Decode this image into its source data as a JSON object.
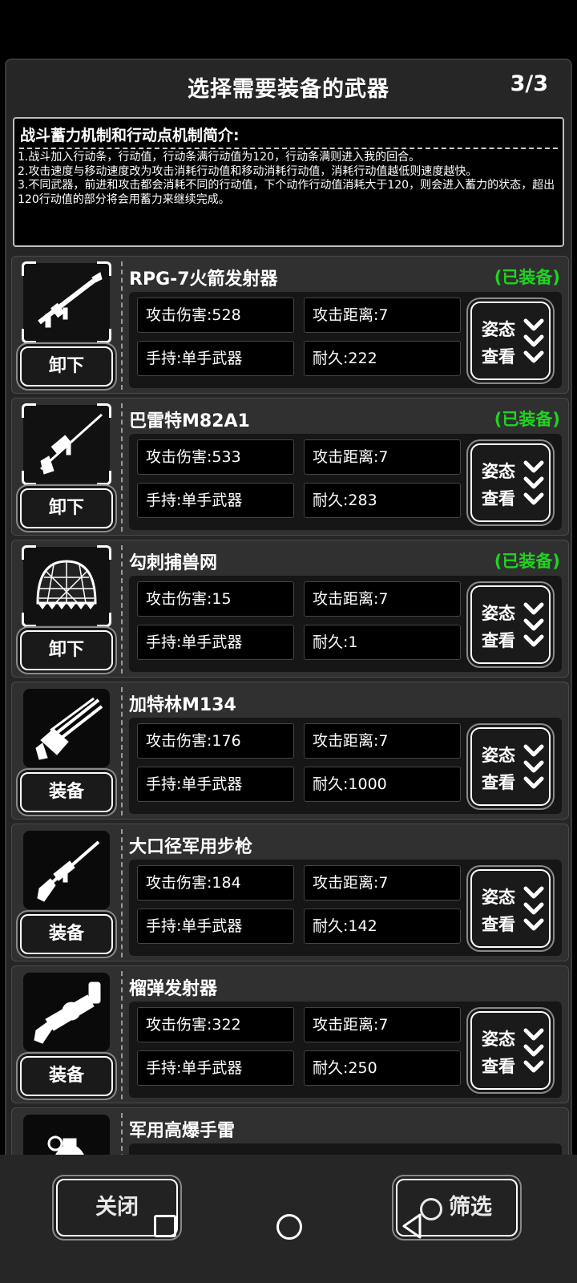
{
  "header": {
    "title": "选择需要装备的武器",
    "page": "3/3"
  },
  "intro": {
    "title": "战斗蓄力机制和行动点机制简介:",
    "lines": [
      "1.战斗加入行动条，行动值，行动条满行动值为120，行动条满则进入我的回合。",
      "2.攻击速度与移动速度改为攻击消耗行动值和移动消耗行动值，消耗行动值越低则速度越快。",
      "3.不同武器，前进和攻击都会消耗不同的行动值，下个动作行动值消耗大于120，则会进入蓄力的状态，超出120行动值的部分将会用蓄力来继续完成。"
    ]
  },
  "weapons": [
    {
      "name": "RPG-7火箭发射器",
      "equipped_tag": "(已装备)",
      "action": "卸下",
      "damage": "攻击伤害:528",
      "range": "攻击距离:7",
      "hold": "手持:单手武器",
      "durability": "耐久:222",
      "view_label": "姿态查看",
      "icon": "rpg-launcher-icon"
    },
    {
      "name": "巴雷特M82A1",
      "equipped_tag": "(已装备)",
      "action": "卸下",
      "damage": "攻击伤害:533",
      "range": "攻击距离:7",
      "hold": "手持:单手武器",
      "durability": "耐久:283",
      "view_label": "姿态查看",
      "icon": "sniper-rifle-icon"
    },
    {
      "name": "勾刺捕兽网",
      "equipped_tag": "(已装备)",
      "action": "卸下",
      "damage": "攻击伤害:15",
      "range": "攻击距离:7",
      "hold": "手持:单手武器",
      "durability": "耐久:1",
      "view_label": "姿态查看",
      "icon": "net-icon"
    },
    {
      "name": "加特林M134",
      "equipped_tag": "",
      "action": "装备",
      "damage": "攻击伤害:176",
      "range": "攻击距离:7",
      "hold": "手持:单手武器",
      "durability": "耐久:1000",
      "view_label": "姿态查看",
      "icon": "minigun-icon"
    },
    {
      "name": "大口径军用步枪",
      "equipped_tag": "",
      "action": "装备",
      "damage": "攻击伤害:184",
      "range": "攻击距离:7",
      "hold": "手持:单手武器",
      "durability": "耐久:142",
      "view_label": "姿态查看",
      "icon": "rifle-icon"
    },
    {
      "name": "榴弹发射器",
      "equipped_tag": "",
      "action": "装备",
      "damage": "攻击伤害:322",
      "range": "攻击距离:7",
      "hold": "手持:单手武器",
      "durability": "耐久:250",
      "view_label": "姿态查看",
      "icon": "grenade-launcher-icon"
    },
    {
      "name": "军用高爆手雷",
      "equipped_tag": "",
      "action": "",
      "damage": "",
      "range": "",
      "hold": "",
      "durability": "",
      "view_label": "",
      "icon": "grenade-icon"
    }
  ],
  "footer": {
    "close_label": "关闭",
    "filter_label": "筛选"
  },
  "colors": {
    "equipped": "#21d321",
    "panel": "#262626"
  }
}
